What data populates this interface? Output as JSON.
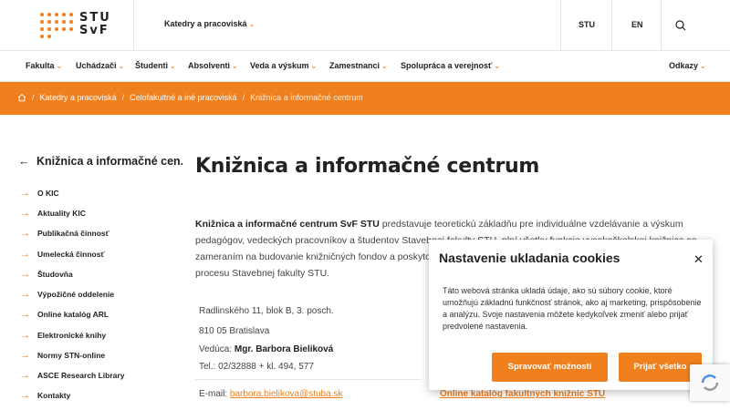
{
  "header": {
    "logo_text_line1": "STU",
    "logo_text_line2": "SvF",
    "dropdown_label": "Katedry a pracoviská",
    "links": [
      "STU",
      "EN"
    ],
    "search_icon": "search-icon"
  },
  "nav": {
    "items": [
      "Fakulta",
      "Uchádzači",
      "Študenti",
      "Absolventi",
      "Veda a výskum",
      "Zamestnanci",
      "Spolupráca a verejnosť",
      "Odkazy"
    ]
  },
  "breadcrumb": {
    "home_icon": "home-icon",
    "items": [
      "Katedry a pracoviská",
      "Celofakultné a iné pracoviská",
      "Knižnica a informačné centrum"
    ]
  },
  "sidebar": {
    "heading": "Knižnica a informačné cen...",
    "items": [
      "O KIC",
      "Aktuality KIC",
      "Publikačná činnosť",
      "Umelecká činnosť",
      "Študovňa",
      "Výpožičné oddelenie",
      "Online katalóg ARL",
      "Elektronické knihy",
      "Normy STN-online",
      "ASCE Research Library",
      "Kontakty"
    ]
  },
  "content": {
    "title": "Knižnica a informačné centrum",
    "intro_bold": "Knižnica a informačné centrum SvF STU",
    "intro_rest": " predstavuje teoretickú základňu pre individuálne vzdelávanie a výskum pedagógov, vedeckých pracovníkov a študentov Stavebnej fakulty STU, plní všetky funkcie vysokoškolskej knižnice so zameraním na budovanie knižničných fondov a poskytovanie služieb pre zabezpečenie vzdelávacieho a výskumného procesu Stavebnej fakulty STU.",
    "address_line1": "Radlinského 11, blok B, 3. posch.",
    "address_line2": "810 05 Bratislava",
    "head_label": "Vedúca: ",
    "head_name": "Mgr. Barbora Bieliková",
    "phone": "Tel.: 02/32888 + kl. 494, 577",
    "email_label": "E-mail: ",
    "email": "barbora.bielikova@stuba.sk",
    "catalog_link": "Online katalóg fakultných knižníc STU"
  },
  "cookie": {
    "title": "Nastavenie ukladania cookies",
    "text": "Táto webová stránka ukladá údaje, ako sú súbory cookie, ktoré umožňujú základnú funkčnosť stránok, ako aj marketing, prispôsobenie a analýzu. Svoje nastavenia môžete kedykoľvek zmeniť alebo prijať predvolené nastavenia.",
    "settings_button": "Spravovať možnosti",
    "accept_button": "Prijať všetko",
    "close_icon": "close-icon"
  },
  "colors": {
    "accent": "#f07f1d",
    "text": "#222222",
    "border": "#e6e6e6"
  }
}
